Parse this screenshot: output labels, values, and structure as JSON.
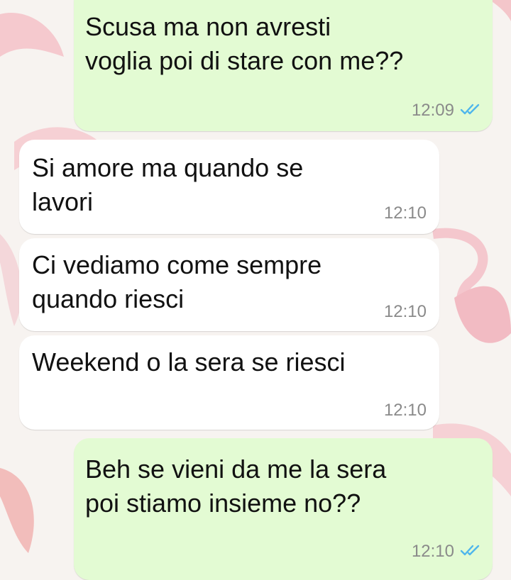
{
  "chat": {
    "messages": [
      {
        "direction": "outgoing",
        "text": "Scusa ma non avresti\nvoglia poi di stare con me??",
        "time": "12:09",
        "status": "double-check-read-icon"
      },
      {
        "direction": "incoming",
        "text": "Si amore ma quando se\nlavori",
        "time": "12:10"
      },
      {
        "direction": "incoming",
        "text": "Ci vediamo come sempre\nquando riesci",
        "time": "12:10"
      },
      {
        "direction": "incoming",
        "text": "Weekend o la sera se riesci",
        "time": "12:10"
      },
      {
        "direction": "outgoing",
        "text": "Beh se vieni da me la sera\npoi stiamo insieme no??",
        "time": "12:10",
        "status": "double-check-read-icon"
      }
    ]
  },
  "colors": {
    "outgoing_bubble": "#e3fbd3",
    "incoming_bubble": "#ffffff",
    "read_ticks": "#4fb6ec",
    "timestamp": "#8a8a8a",
    "wallpaper": "#f7f3f0",
    "wallpaper_accent": "#f29aa8"
  },
  "wallpaper": {
    "theme": "flamingo-pattern"
  }
}
